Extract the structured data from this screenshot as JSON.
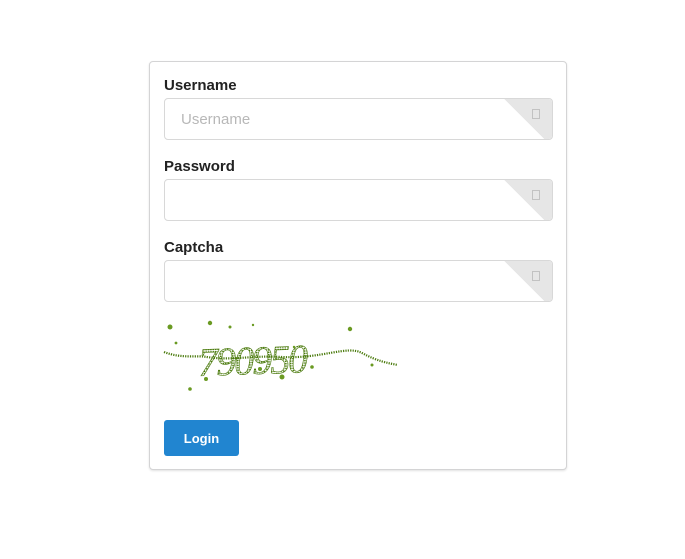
{
  "form": {
    "username": {
      "label": "Username",
      "placeholder": "Username",
      "value": ""
    },
    "password": {
      "label": "Password",
      "placeholder": "",
      "value": ""
    },
    "captcha": {
      "label": "Captcha",
      "placeholder": "",
      "value": "",
      "image_text": "790950"
    },
    "login_label": "Login"
  },
  "colors": {
    "primary": "#2185d0",
    "captcha_ink": "#4a7a0c"
  },
  "icons": {
    "field_corner": "field-corner-icon"
  }
}
